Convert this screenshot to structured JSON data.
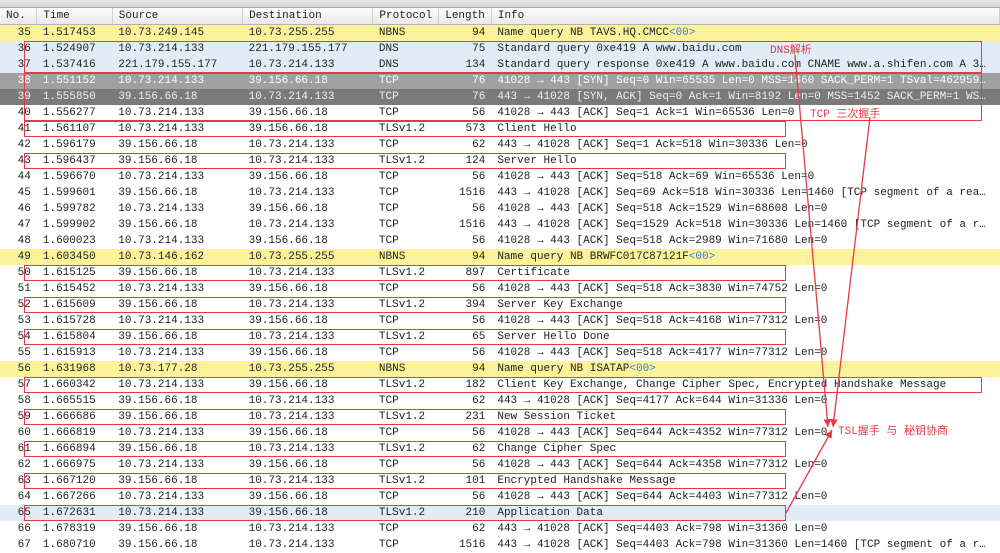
{
  "columns": {
    "no": "No.",
    "time": "Time",
    "src": "Source",
    "dst": "Destination",
    "proto": "Protocol",
    "len": "Length",
    "info": "Info"
  },
  "rows": [
    {
      "no": "35",
      "time": "1.517453",
      "src": "10.73.249.145",
      "dst": "10.73.255.255",
      "proto": "NBNS",
      "len": "94",
      "info": "Name query NB TAVS.HQ.CMCC<00>",
      "cls": "yellow"
    },
    {
      "no": "36",
      "time": "1.524907",
      "src": "10.73.214.133",
      "dst": "221.179.155.177",
      "proto": "DNS",
      "len": "75",
      "info": "Standard query 0xe419 A www.baidu.com",
      "cls": "lightblue"
    },
    {
      "no": "37",
      "time": "1.537416",
      "src": "221.179.155.177",
      "dst": "10.73.214.133",
      "proto": "DNS",
      "len": "134",
      "info": "Standard query response 0xe419 A www.baidu.com CNAME www.a.shifen.com A 3…",
      "cls": "lightblue"
    },
    {
      "no": "38",
      "time": "1.551152",
      "src": "10.73.214.133",
      "dst": "39.156.66.18",
      "proto": "TCP",
      "len": "76",
      "info": "41028 → 443 [SYN] Seq=0 Win=65535 Len=0 MSS=1460 SACK_PERM=1 TSval=462959…",
      "cls": "darkgray"
    },
    {
      "no": "39",
      "time": "1.555850",
      "src": "39.156.66.18",
      "dst": "10.73.214.133",
      "proto": "TCP",
      "len": "76",
      "info": "443 → 41028 [SYN, ACK] Seq=0 Ack=1 Win=8192 Len=0 MSS=1452 SACK_PERM=1 WS…",
      "cls": "gray"
    },
    {
      "no": "40",
      "time": "1.556277",
      "src": "10.73.214.133",
      "dst": "39.156.66.18",
      "proto": "TCP",
      "len": "56",
      "info": "41028 → 443 [ACK] Seq=1 Ack=1 Win=65536 Len=0",
      "cls": "white"
    },
    {
      "no": "41",
      "time": "1.561107",
      "src": "10.73.214.133",
      "dst": "39.156.66.18",
      "proto": "TLSv1.2",
      "len": "573",
      "info": "Client Hello",
      "cls": "white"
    },
    {
      "no": "42",
      "time": "1.596179",
      "src": "39.156.66.18",
      "dst": "10.73.214.133",
      "proto": "TCP",
      "len": "62",
      "info": "443 → 41028 [ACK] Seq=1 Ack=518 Win=30336 Len=0",
      "cls": "white"
    },
    {
      "no": "43",
      "time": "1.596437",
      "src": "39.156.66.18",
      "dst": "10.73.214.133",
      "proto": "TLSv1.2",
      "len": "124",
      "info": "Server Hello",
      "cls": "white"
    },
    {
      "no": "44",
      "time": "1.596670",
      "src": "10.73.214.133",
      "dst": "39.156.66.18",
      "proto": "TCP",
      "len": "56",
      "info": "41028 → 443 [ACK] Seq=518 Ack=69 Win=65536 Len=0",
      "cls": "white"
    },
    {
      "no": "45",
      "time": "1.599601",
      "src": "39.156.66.18",
      "dst": "10.73.214.133",
      "proto": "TCP",
      "len": "1516",
      "info": "443 → 41028 [ACK] Seq=69 Ack=518 Win=30336 Len=1460 [TCP segment of a rea…",
      "cls": "white"
    },
    {
      "no": "46",
      "time": "1.599782",
      "src": "10.73.214.133",
      "dst": "39.156.66.18",
      "proto": "TCP",
      "len": "56",
      "info": "41028 → 443 [ACK] Seq=518 Ack=1529 Win=68608 Len=0",
      "cls": "white"
    },
    {
      "no": "47",
      "time": "1.599902",
      "src": "39.156.66.18",
      "dst": "10.73.214.133",
      "proto": "TCP",
      "len": "1516",
      "info": "443 → 41028 [ACK] Seq=1529 Ack=518 Win=30336 Len=1460 [TCP segment of a r…",
      "cls": "white"
    },
    {
      "no": "48",
      "time": "1.600023",
      "src": "10.73.214.133",
      "dst": "39.156.66.18",
      "proto": "TCP",
      "len": "56",
      "info": "41028 → 443 [ACK] Seq=518 Ack=2989 Win=71680 Len=0",
      "cls": "white"
    },
    {
      "no": "49",
      "time": "1.603450",
      "src": "10.73.146.162",
      "dst": "10.73.255.255",
      "proto": "NBNS",
      "len": "94",
      "info": "Name query NB BRWFC017C87121F<00>",
      "cls": "yellow"
    },
    {
      "no": "50",
      "time": "1.615125",
      "src": "39.156.66.18",
      "dst": "10.73.214.133",
      "proto": "TLSv1.2",
      "len": "897",
      "info": "Certificate",
      "cls": "white"
    },
    {
      "no": "51",
      "time": "1.615452",
      "src": "10.73.214.133",
      "dst": "39.156.66.18",
      "proto": "TCP",
      "len": "56",
      "info": "41028 → 443 [ACK] Seq=518 Ack=3830 Win=74752 Len=0",
      "cls": "white"
    },
    {
      "no": "52",
      "time": "1.615609",
      "src": "39.156.66.18",
      "dst": "10.73.214.133",
      "proto": "TLSv1.2",
      "len": "394",
      "info": "Server Key Exchange",
      "cls": "white"
    },
    {
      "no": "53",
      "time": "1.615728",
      "src": "10.73.214.133",
      "dst": "39.156.66.18",
      "proto": "TCP",
      "len": "56",
      "info": "41028 → 443 [ACK] Seq=518 Ack=4168 Win=77312 Len=0",
      "cls": "white"
    },
    {
      "no": "54",
      "time": "1.615804",
      "src": "39.156.66.18",
      "dst": "10.73.214.133",
      "proto": "TLSv1.2",
      "len": "65",
      "info": "Server Hello Done",
      "cls": "white"
    },
    {
      "no": "55",
      "time": "1.615913",
      "src": "10.73.214.133",
      "dst": "39.156.66.18",
      "proto": "TCP",
      "len": "56",
      "info": "41028 → 443 [ACK] Seq=518 Ack=4177 Win=77312 Len=0",
      "cls": "white"
    },
    {
      "no": "56",
      "time": "1.631968",
      "src": "10.73.177.28",
      "dst": "10.73.255.255",
      "proto": "NBNS",
      "len": "94",
      "info": "Name query NB ISATAP<00>",
      "cls": "yellow"
    },
    {
      "no": "57",
      "time": "1.660342",
      "src": "10.73.214.133",
      "dst": "39.156.66.18",
      "proto": "TLSv1.2",
      "len": "182",
      "info": "Client Key Exchange, Change Cipher Spec, Encrypted Handshake Message",
      "cls": "white"
    },
    {
      "no": "58",
      "time": "1.665515",
      "src": "39.156.66.18",
      "dst": "10.73.214.133",
      "proto": "TCP",
      "len": "62",
      "info": "443 → 41028 [ACK] Seq=4177 Ack=644 Win=31336 Len=0",
      "cls": "white"
    },
    {
      "no": "59",
      "time": "1.666686",
      "src": "39.156.66.18",
      "dst": "10.73.214.133",
      "proto": "TLSv1.2",
      "len": "231",
      "info": "New Session Ticket",
      "cls": "white"
    },
    {
      "no": "60",
      "time": "1.666819",
      "src": "10.73.214.133",
      "dst": "39.156.66.18",
      "proto": "TCP",
      "len": "56",
      "info": "41028 → 443 [ACK] Seq=644 Ack=4352 Win=77312 Len=0",
      "cls": "white"
    },
    {
      "no": "61",
      "time": "1.666894",
      "src": "39.156.66.18",
      "dst": "10.73.214.133",
      "proto": "TLSv1.2",
      "len": "62",
      "info": "Change Cipher Spec",
      "cls": "white"
    },
    {
      "no": "62",
      "time": "1.666975",
      "src": "10.73.214.133",
      "dst": "39.156.66.18",
      "proto": "TCP",
      "len": "56",
      "info": "41028 → 443 [ACK] Seq=644 Ack=4358 Win=77312 Len=0",
      "cls": "white"
    },
    {
      "no": "63",
      "time": "1.667120",
      "src": "39.156.66.18",
      "dst": "10.73.214.133",
      "proto": "TLSv1.2",
      "len": "101",
      "info": "Encrypted Handshake Message",
      "cls": "white"
    },
    {
      "no": "64",
      "time": "1.667266",
      "src": "10.73.214.133",
      "dst": "39.156.66.18",
      "proto": "TCP",
      "len": "56",
      "info": "41028 → 443 [ACK] Seq=644 Ack=4403 Win=77312 Len=0",
      "cls": "white"
    },
    {
      "no": "65",
      "time": "1.672631",
      "src": "10.73.214.133",
      "dst": "39.156.66.18",
      "proto": "TLSv1.2",
      "len": "210",
      "info": "Application Data",
      "cls": "lightblue"
    },
    {
      "no": "66",
      "time": "1.678319",
      "src": "39.156.66.18",
      "dst": "10.73.214.133",
      "proto": "TCP",
      "len": "62",
      "info": "443 → 41028 [ACK] Seq=4403 Ack=798 Win=31360 Len=0",
      "cls": "white"
    },
    {
      "no": "67",
      "time": "1.680710",
      "src": "39.156.66.18",
      "dst": "10.73.214.133",
      "proto": "TCP",
      "len": "1516",
      "info": "443 → 41028 [ACK] Seq=4403 Ack=798 Win=31360 Len=1460 [TCP segment of a r…",
      "cls": "white"
    }
  ],
  "annotations": {
    "dns": "DNS解析",
    "tcp": "TCP 三次握手",
    "tls": "TSL握手 与 秘钥协商"
  }
}
